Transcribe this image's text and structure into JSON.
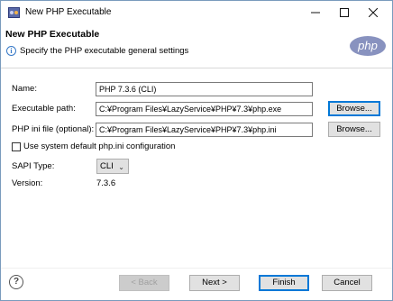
{
  "window": {
    "title": "New PHP Executable",
    "icon": "php-window-icon"
  },
  "banner": {
    "title": "New PHP Executable",
    "description": "Specify the PHP executable general settings",
    "logo_text": "php"
  },
  "form": {
    "name_label": "Name:",
    "name_value": "PHP 7.3.6 (CLI)",
    "exec_label": "Executable path:",
    "exec_value": "C:¥Program Files¥LazyService¥PHP¥7.3¥php.exe",
    "ini_label": "PHP ini file (optional):",
    "ini_value": "C:¥Program Files¥LazyService¥PHP¥7.3¥php.ini",
    "browse_label": "Browse...",
    "use_default_ini_label": "Use system default php.ini configuration",
    "use_default_ini_checked": false,
    "sapi_label": "SAPI Type:",
    "sapi_value": "CLI",
    "version_label": "Version:",
    "version_value": "7.3.6"
  },
  "buttons": {
    "back": "< Back",
    "next": "Next >",
    "finish": "Finish",
    "cancel": "Cancel"
  },
  "colors": {
    "focus_accent": "#0078d7",
    "php_logo": "#8892bf",
    "info_icon": "#3779c7"
  }
}
